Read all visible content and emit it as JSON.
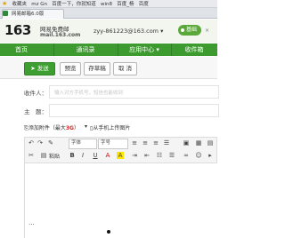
{
  "browser": {
    "bookmarks": [
      "收藏夹",
      "mz Gn",
      "百度一下，你就知道",
      "win8",
      "百度_杨",
      "百度"
    ],
    "tab_title": "网易邮箱6.0版"
  },
  "mail_header": {
    "logo_number": "163",
    "logo_title": "网易免费邮",
    "logo_domain": "mail.163.com",
    "account": "zyy-861223@163.com ▾",
    "badge_label": "基础",
    "badge_close": "×"
  },
  "nav": {
    "items": [
      "首页",
      "通讯录",
      "应用中心 ▾",
      "收件箱"
    ]
  },
  "compose_toolbar": {
    "send_label": "发送",
    "preview_label": "预览",
    "draft_label": "存草稿",
    "cancel_label": "取 消"
  },
  "fields": {
    "to_label": "收件人：",
    "to_placeholder": "输入对方手机号，短信也能收到",
    "subject_label": "主　题："
  },
  "attachments": {
    "add_attachment": "添加附件（最大",
    "size_limit": "3G",
    "add_attachment_end": "）",
    "phone_upload": "从手机上传图片"
  },
  "editor_toolbar": {
    "font_select": "字体",
    "size_select": "字号",
    "paste_label": "粘贴"
  },
  "editor": {
    "body_marker": "..."
  },
  "colors": {
    "nav_green": "#3c9a2e",
    "send_green": "#3f9e32",
    "attach_red": "#dd2222"
  }
}
